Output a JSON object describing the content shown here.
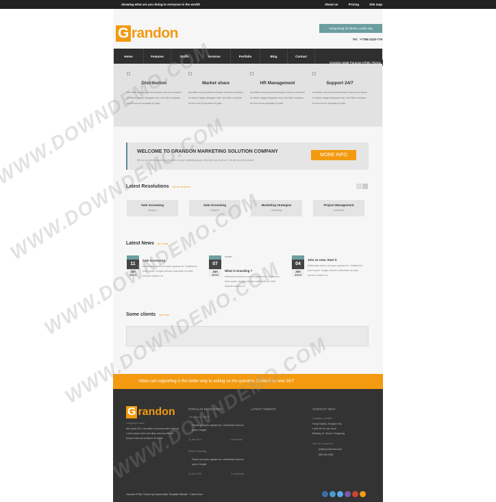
{
  "topbar": {
    "tagline": "showing what are you doing to everyone in the world!",
    "links": [
      "About us",
      "Pricing",
      "Site map"
    ]
  },
  "brand": {
    "logo_first": "G",
    "logo_rest": "randon"
  },
  "header": {
    "address": "Hong kong 32 street, Lorkie city",
    "tel": "Tel : +7788-2220-779"
  },
  "nav": {
    "items": [
      "Home",
      "Features",
      "Stuffs",
      "Services",
      "Portfolio",
      "Blog",
      "Contact"
    ],
    "theme_label": "Grandon Multi-Purpose HTML Theme"
  },
  "features": [
    {
      "title": "Distribution",
      "text": "sed diam nonumy eirmod tempor invid unt ut labore et dolore magna aliquyam erat, sed diam voluptua. at vero eos et accusam et justo"
    },
    {
      "title": "Market share",
      "text": "sed diam nonumy eirmod tempor invid unt ut labore et dolore magna aliquyam erat, sed diam voluptua. at vero eos et accusam et justo"
    },
    {
      "title": "HR Management",
      "text": "sed diam nonumy eirmod tempor invid unt ut labore et dolore magna aliquyam erat, sed diam voluptua. at vero eos et accusam et justo"
    },
    {
      "title": "Support 24/7",
      "text": "sed diam nonumy eirmod tempor invid unt ut labore et dolore magna aliquyam erat, sed diam voluptua. at vero eos et accusam et justo"
    }
  ],
  "welcome": {
    "title": "WELCOME TO GRANDON MARKETING SOLUTION COMPANY",
    "text": "We do our best to solve any problem on your marketing issue, why don't you trust us ? we are your first choice",
    "button": "MORE INFO"
  },
  "resolutions": {
    "title": "Latest Resolutions",
    "link": "see all resolution",
    "items": [
      {
        "title": "Sale increasing",
        "sub": "shagesi"
      },
      {
        "title": "Sale increasing",
        "sub": "shagesi"
      },
      {
        "title": "Marketing strategies",
        "sub": "marketing"
      },
      {
        "title": "Project Management",
        "sub": "consultant"
      }
    ]
  },
  "news": {
    "title": "Latest News",
    "link": "go to blog",
    "items": [
      {
        "day": "11",
        "month": "Jan",
        "year": "2013",
        "title": "Sale increasing",
        "text": "Malesuada fames ac turpis egestas leo. Vestibulum tortor quam, feugiat ultricies sollicitudin sit amet. Aenean ultricies mi"
      },
      {
        "day": "07",
        "month": "Jan",
        "year": "2013",
        "title": "What is branding ?",
        "text": "Malesuada fames ac turpis egestas leo. Vestibulum tortor quam, feugiat ultricies sollicitudin sit amet. Aenean ultricies mi",
        "image_alt": "header"
      },
      {
        "day": "04",
        "month": "Jan",
        "year": "2013",
        "title": "Join us now, Start it",
        "text": "Malesuada fames ac turpis egestas leo. Vestibulum tortor quam, feugiat ultricies sollicitudin sit amet. Aenean ultricies mi"
      }
    ]
  },
  "clients": {
    "title": "Some clients",
    "link": "see more"
  },
  "callout": "Video call supporting is the better way to asking us the question. Contact us now 24/7",
  "footer": {
    "company_label": "Company's name",
    "company_text": "We supoil 24/7, sed diam nonummy nibh euismod Lorem ipsum dolor sed diam nonumy eirmod tempor invid unt ut labore et dolore",
    "popular_title": "POPULAR BLOG POST",
    "posts": [
      {
        "title": "Join us now, Start it",
        "text": "Fames ac turpis egestas leo. vestibulum tortorna quam, feugiat",
        "date": "11 Jan 2013",
        "comments": "2 comments"
      },
      {
        "title": "What is branding",
        "text": "Fames ac turpis egestas leo. vestibulum tortorna quam, feugiat",
        "date": "11 Jan 2013",
        "comments": "3 comments"
      }
    ],
    "tweets_title": "LATEST TWEETS",
    "contact_title": "CONTACT INFO",
    "contact_label": "Company Location",
    "contact_lines": [
      "Hong Studios, Kongkor City",
      "Lucid 36 Rd. sai shool",
      "Building 12, Mount, Hongkong"
    ],
    "how_label": "How To Contact Us",
    "email": "job@yourdomain.com",
    "phone": "888-440-3381",
    "copyright": "Grandon HTML Theme by Dames Mark Template Website · Collect from"
  },
  "watermark": "WWW.DOWNDEMO.COM",
  "colors": {
    "accent": "#f39a10",
    "teal": "#6c9ea0",
    "dark": "#333333"
  }
}
